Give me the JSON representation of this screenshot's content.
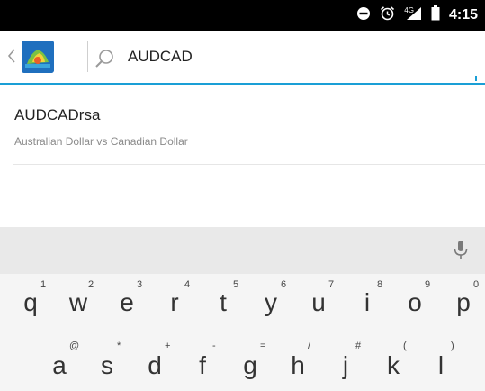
{
  "status_bar": {
    "time": "4:15",
    "network": "4G",
    "icons": [
      "dnd-icon",
      "alarm-icon",
      "signal-icon",
      "battery-icon"
    ]
  },
  "search": {
    "query": "AUDCAD",
    "accent_color": "#1a9fd6"
  },
  "results": [
    {
      "symbol": "AUDCADrsa",
      "description": "Australian Dollar vs Canadian Dollar"
    }
  ],
  "keyboard": {
    "row1": [
      {
        "key": "q",
        "hint": "1"
      },
      {
        "key": "w",
        "hint": "2"
      },
      {
        "key": "e",
        "hint": "3"
      },
      {
        "key": "r",
        "hint": "4"
      },
      {
        "key": "t",
        "hint": "5"
      },
      {
        "key": "y",
        "hint": "6"
      },
      {
        "key": "u",
        "hint": "7"
      },
      {
        "key": "i",
        "hint": "8"
      },
      {
        "key": "o",
        "hint": "9"
      },
      {
        "key": "p",
        "hint": "0"
      }
    ],
    "row2": [
      {
        "key": "a",
        "hint": "@"
      },
      {
        "key": "s",
        "hint": "*"
      },
      {
        "key": "d",
        "hint": "+"
      },
      {
        "key": "f",
        "hint": "-"
      },
      {
        "key": "g",
        "hint": "="
      },
      {
        "key": "h",
        "hint": "/"
      },
      {
        "key": "j",
        "hint": "#"
      },
      {
        "key": "k",
        "hint": "("
      },
      {
        "key": "l",
        "hint": ")"
      }
    ]
  }
}
